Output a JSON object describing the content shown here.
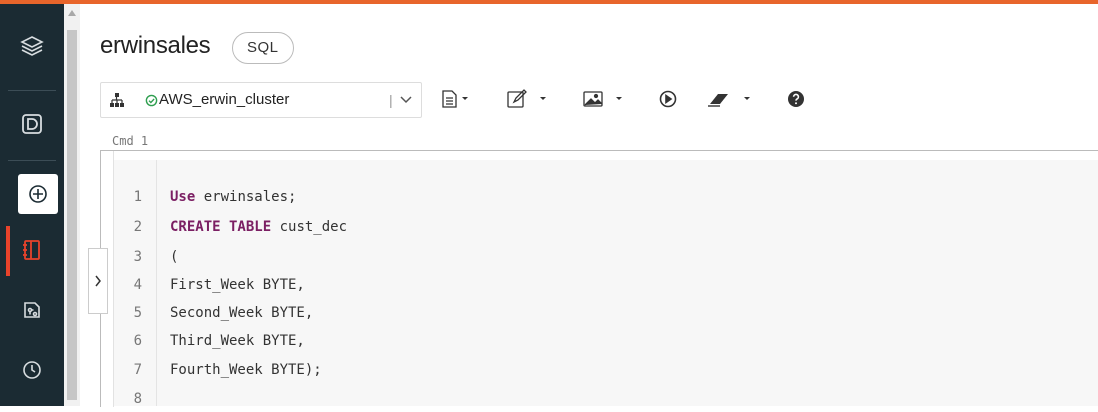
{
  "notebook": {
    "title": "erwinsales",
    "language_badge": "SQL"
  },
  "toolbar": {
    "cluster_status_icon": "check-circle-icon",
    "cluster_name": "AWS_erwin_cluster",
    "icons": [
      "cluster-tree-icon",
      "file-icon",
      "edit-icon",
      "image-icon",
      "run-icon",
      "eraser-icon",
      "help-icon"
    ]
  },
  "cell": {
    "label": "Cmd 1",
    "lines": [
      {
        "n": "1",
        "kw": "Use",
        "rest": " erwinsales;"
      },
      {
        "n": "2",
        "kw": "CREATE TABLE",
        "rest": " cust_dec"
      },
      {
        "n": "3",
        "kw": "",
        "rest": "("
      },
      {
        "n": "4",
        "kw": "",
        "rest": "First_Week BYTE,"
      },
      {
        "n": "5",
        "kw": "",
        "rest": "Second_Week BYTE,"
      },
      {
        "n": "6",
        "kw": "",
        "rest": "Third_Week BYTE,"
      },
      {
        "n": "7",
        "kw": "",
        "rest": "Fourth_Week BYTE);"
      },
      {
        "n": "8",
        "kw": "",
        "rest": ""
      }
    ]
  },
  "colors": {
    "accent": "#e8652b",
    "sidebar": "#1b2b33",
    "keyword": "#7b1f63",
    "status_ok": "#2e9e4f"
  }
}
